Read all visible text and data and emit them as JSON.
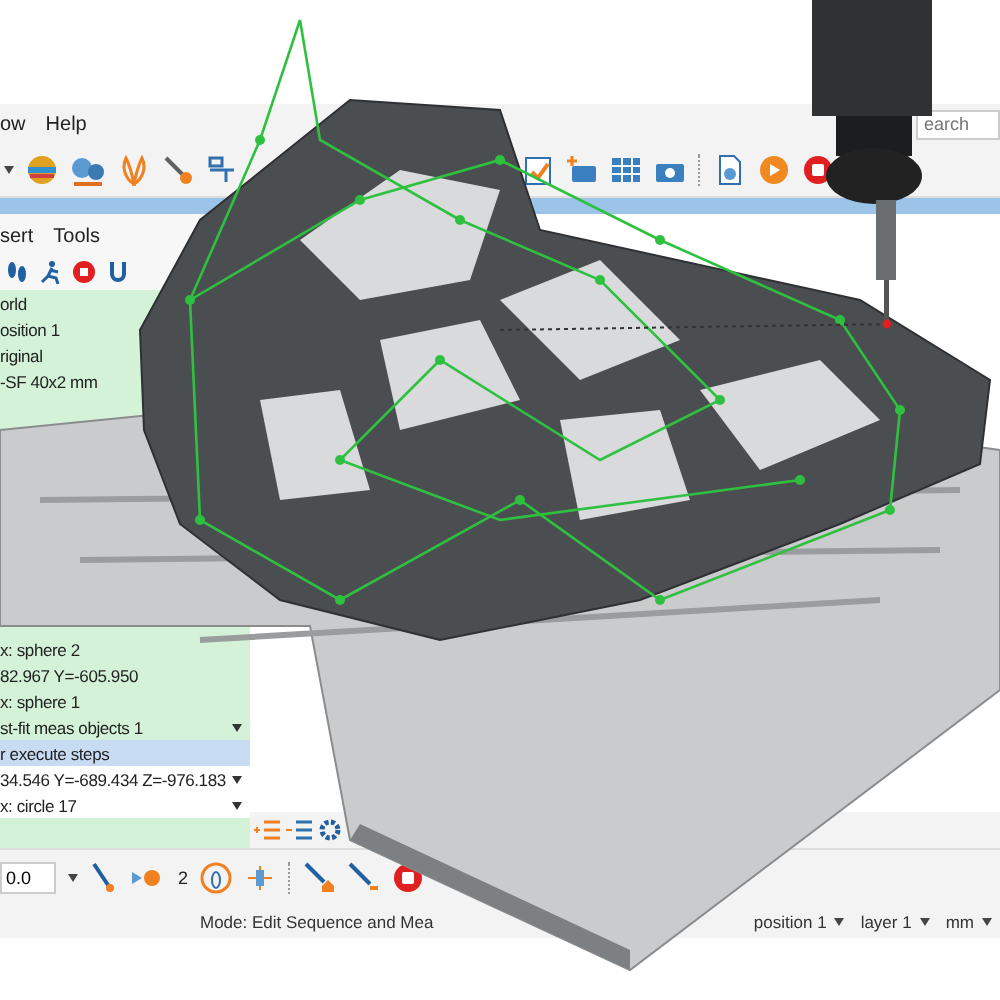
{
  "menu": [
    {
      "label": "ow"
    },
    {
      "label": "Help"
    }
  ],
  "search": {
    "placeholder": "earch"
  },
  "panel": {
    "menu": [
      {
        "label": "sert"
      },
      {
        "label": "Tools"
      }
    ],
    "top_items": [
      {
        "text": "orld",
        "kind": "step",
        "selected": false
      },
      {
        "text": "osition 1",
        "kind": "step",
        "selected": false
      },
      {
        "text": "riginal",
        "kind": "step",
        "selected": false
      },
      {
        "text": "-SF 40x2 mm",
        "kind": "step",
        "selected": false
      }
    ],
    "bottom_items": [
      {
        "text": "x: sphere 2",
        "kind": "step",
        "selected": false
      },
      {
        "text": "82.967 Y=-605.950",
        "kind": "step",
        "selected": false
      },
      {
        "text": "x: sphere 1",
        "kind": "step",
        "selected": false
      },
      {
        "text": "st-fit meas objects 1",
        "kind": "step_menu",
        "selected": false
      },
      {
        "text": "r execute steps",
        "kind": "step",
        "selected": true
      },
      {
        "text": "34.546 Y=-689.434 Z=-976.183",
        "kind": "field",
        "selected": false
      },
      {
        "text": "x: circle 17",
        "kind": "field",
        "selected": false
      }
    ]
  },
  "bottom_toolbar": {
    "field_value": "0.0",
    "count": "2"
  },
  "status_bar": {
    "mode": "Mode: Edit Sequence and Mea",
    "dropdowns": [
      {
        "label": "position 1"
      },
      {
        "label": "layer 1"
      },
      {
        "label": "mm"
      }
    ]
  }
}
